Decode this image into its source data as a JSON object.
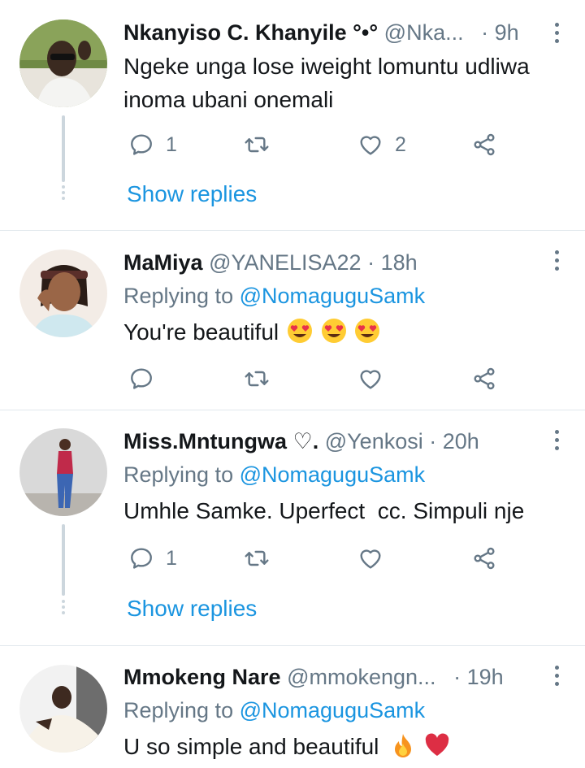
{
  "tweets": [
    {
      "name": "Nkanyiso C. Khanyile °•°",
      "handle": "@Nka...",
      "time": "· 9h",
      "replying_label": "",
      "replying_to": "",
      "text": "Ngeke unga lose iweight lomuntu udliwa inoma ubani onemali",
      "emoji": [],
      "reply_count": "1",
      "retweet_count": "",
      "like_count": "2",
      "show_replies": "Show replies"
    },
    {
      "name": "MaMiya",
      "handle": "@YANELISA22",
      "time": "· 18h",
      "replying_label": "Replying to",
      "replying_to": "@NomaguguSamk",
      "text": "You're beautiful",
      "emoji": [
        "heart-eyes-emoji",
        "heart-eyes-emoji",
        "heart-eyes-emoji"
      ],
      "reply_count": "",
      "retweet_count": "",
      "like_count": "",
      "show_replies": ""
    },
    {
      "name": "Miss.Mntungwa ♡.",
      "handle": "@Yenkosi",
      "time": "· 20h",
      "replying_label": "Replying to",
      "replying_to": "@NomaguguSamk",
      "text": "Umhle Samke. Uperfect  cc. Simpuli nje",
      "emoji": [],
      "reply_count": "1",
      "retweet_count": "",
      "like_count": "",
      "show_replies": "Show replies"
    },
    {
      "name": "Mmokeng Nare",
      "handle": "@mmokengn...",
      "time": "· 19h",
      "replying_label": "Replying to",
      "replying_to": "@NomaguguSamk",
      "text": "U so simple and beautiful",
      "emoji": [
        "fire-emoji",
        "red-heart-emoji"
      ],
      "reply_count": "",
      "retweet_count": "",
      "like_count": "",
      "show_replies": ""
    }
  ],
  "icons": {
    "reply": "reply-icon",
    "retweet": "retweet-icon",
    "like": "heart-icon",
    "share": "share-icon",
    "more": "more-vertical-icon"
  },
  "colors": {
    "link": "#1b95e0",
    "secondary": "#657786",
    "divider": "#e1e8ed",
    "thread_line": "#ccd6dd"
  }
}
